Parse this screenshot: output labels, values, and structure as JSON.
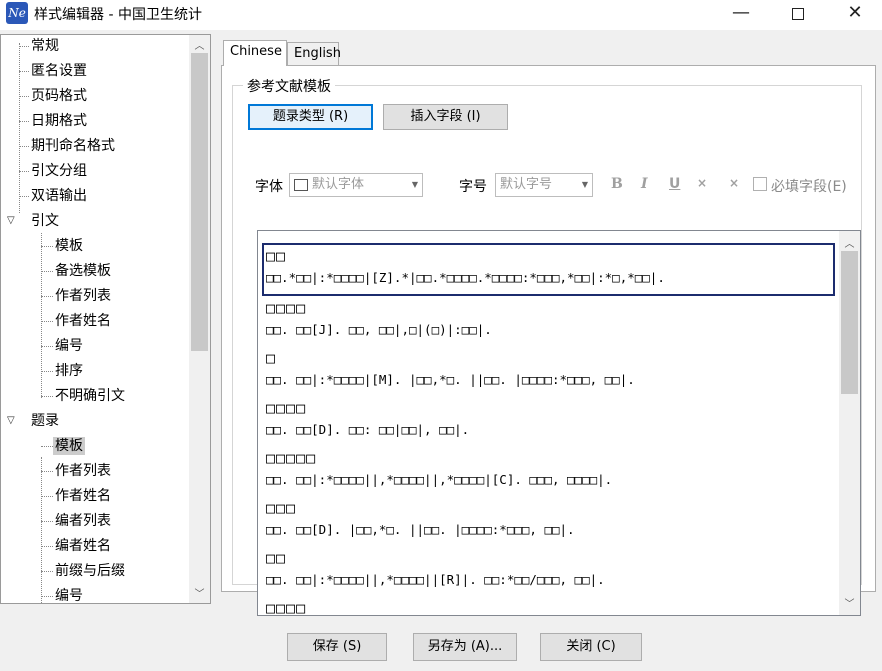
{
  "window": {
    "icon_text": "Ne",
    "title": "样式编辑器 - 中国卫生统计",
    "minimize": "—",
    "close": "✕"
  },
  "tree": {
    "items": [
      {
        "label": "常规"
      },
      {
        "label": "匿名设置"
      },
      {
        "label": "页码格式"
      },
      {
        "label": "日期格式"
      },
      {
        "label": "期刊命名格式"
      },
      {
        "label": "引文分组"
      },
      {
        "label": "双语输出"
      },
      {
        "label": "引文"
      },
      {
        "label": "模板"
      },
      {
        "label": "备选模板"
      },
      {
        "label": "作者列表"
      },
      {
        "label": "作者姓名"
      },
      {
        "label": "编号"
      },
      {
        "label": "排序"
      },
      {
        "label": "不明确引文"
      },
      {
        "label": "题录"
      },
      {
        "label": "模板"
      },
      {
        "label": "作者列表"
      },
      {
        "label": "作者姓名"
      },
      {
        "label": "编者列表"
      },
      {
        "label": "编者姓名"
      },
      {
        "label": "前缀与后缀"
      },
      {
        "label": "编号"
      }
    ],
    "selected_index": 16
  },
  "tabs": [
    {
      "label": "Chinese",
      "active": true
    },
    {
      "label": "English",
      "active": false
    }
  ],
  "group": {
    "title": "参考文献模板",
    "btn_type": "题录类型 (R)",
    "btn_insert": "插入字段 (I)",
    "font_label": "字体",
    "font_value": "默认字体",
    "size_label": "字号",
    "size_value": "默认字号",
    "bold": "B",
    "italic": "I",
    "underline": "U",
    "superscript": "×",
    "subscript": "×",
    "required_label": "必填字段(E)",
    "required_checked": false
  },
  "entries": [
    {
      "title": "□□",
      "text": "□□.*□□|:*□□□□|[Z].*|□□.*□□□□.*□□□□:*□□□,*□□|:*□,*□□|."
    },
    {
      "title": "□□□□",
      "text": "□□. □□[J]. □□, □□|,□|(□)|:□□|."
    },
    {
      "title": "□",
      "text": "□□. □□|:*□□□□|[M]. |□□,*□. ||□□. |□□□□:*□□□, □□|."
    },
    {
      "title": "□□□□",
      "text": "□□. □□[D]. □□: □□|□□|, □□|."
    },
    {
      "title": "□□□□□",
      "text": "□□. □□|:*□□□□||,*□□□□||,*□□□□|[C]. □□□, □□□□|."
    },
    {
      "title": "□□□",
      "text": "□□. □□[D]. |□□,*□. ||□□. |□□□□:*□□□, □□|."
    },
    {
      "title": "□□",
      "text": "□□. □□|:*□□□□||,*□□□□||[R]|. □□:*□□/□□□, □□|."
    },
    {
      "title": "□□□□",
      "text": ""
    }
  ],
  "buttons": {
    "save": "保存 (S)",
    "save_as": "另存为 (A)...",
    "close": "关闭 (C)"
  }
}
